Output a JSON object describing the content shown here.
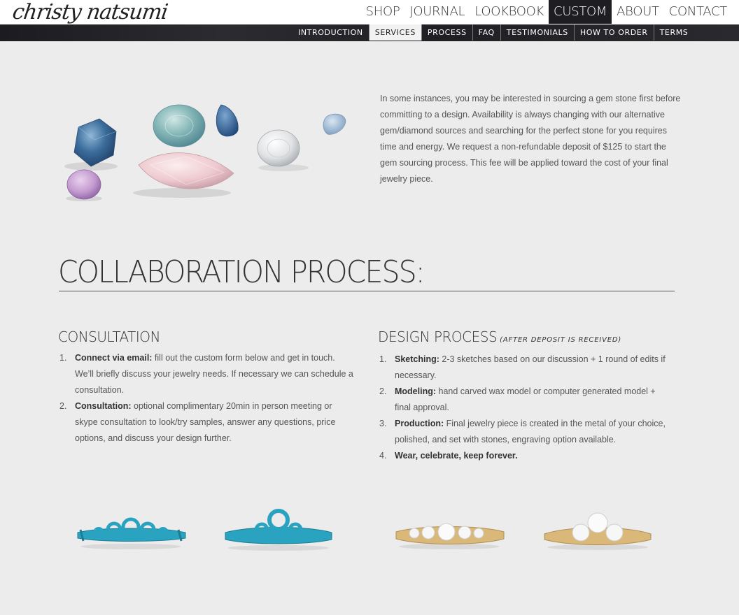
{
  "brand": {
    "logo_text": "christy natsumi"
  },
  "main_nav": [
    "SHOP",
    "JOURNAL",
    "LOOKBOOK",
    "CUSTOM",
    "ABOUT",
    "CONTACT"
  ],
  "main_nav_active": "CUSTOM",
  "sub_nav": [
    "INTRODUCTION",
    "SERVICES",
    "PROCESS",
    "FAQ",
    "TESTIMONIALS",
    "HOW TO ORDER",
    "TERMS"
  ],
  "sub_nav_active": "SERVICES",
  "intro_text": "In some instances, you may be interested in sourcing a gem stone first before committing to a design. Availability is always changing with our alternative gem/diamond sources and searching for the perfect stone for you requires time and energy. We request a non-refundable deposit of $125 to start the gem sourcing process. This fee will be applied toward the cost of your final jewelry piece.",
  "section_title": "COLLABORATION PROCESS:",
  "consultation": {
    "title": "CONSULTATION",
    "steps": [
      {
        "num": "1.",
        "bold": "Connect via email:",
        "text": " fill out the custom form below and get in touch. We’ll briefly discuss your jewelry needs. If necessary we can schedule a consultation."
      },
      {
        "num": "2.",
        "bold": "Consultation:",
        "text": " optional complimentary 20min in person meeting or skype consultation to look/try samples, answer any questions, price options, and discuss your design further."
      }
    ]
  },
  "design": {
    "title": "DESIGN PROCESS",
    "note": "(AFTER DEPOSIT IS RECEIVED)",
    "steps": [
      {
        "num": "1.",
        "bold": "Sketching:",
        "text": " 2-3 sketches based on our discussion + 1 round of edits if necessary."
      },
      {
        "num": "2.",
        "bold": "Modeling:",
        "text": " hand carved wax model or computer generated model + final approval."
      },
      {
        "num": "3.",
        "bold": "Production:",
        "text": " Final jewelry piece is created in the metal of your choice, polished, and set with stones, engraving option available."
      },
      {
        "num": "4.",
        "bold": "Wear, celebrate, keep forever.",
        "text": ""
      }
    ]
  },
  "colors": {
    "nav_dark": "#1e1e22",
    "background": "#ececec",
    "wax": "#2aa3c0",
    "gold": "#d9b87a"
  }
}
